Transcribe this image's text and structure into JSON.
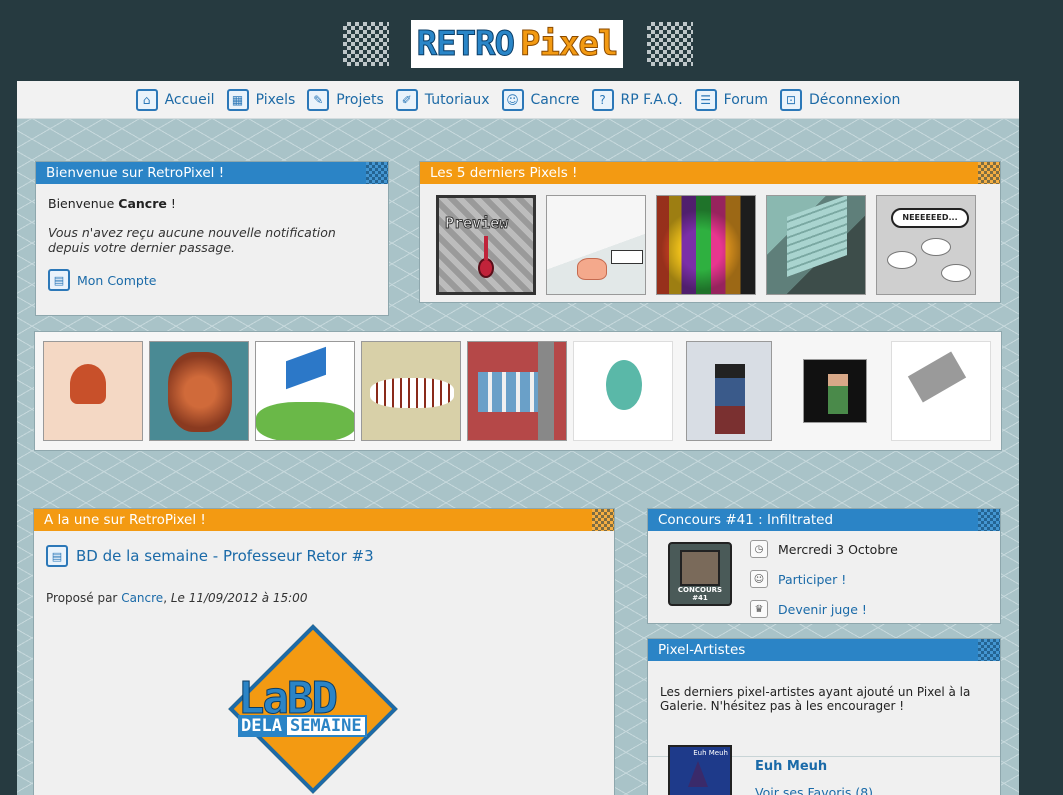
{
  "logo": {
    "retro": "RETRO",
    "pixel": "Pixel"
  },
  "nav": [
    {
      "label": "Accueil",
      "icon": "home-icon",
      "glyph": "⌂"
    },
    {
      "label": "Pixels",
      "icon": "pixels-icon",
      "glyph": "▦"
    },
    {
      "label": "Projets",
      "icon": "pencil-icon",
      "glyph": "✎"
    },
    {
      "label": "Tutoriaux",
      "icon": "tutorial-icon",
      "glyph": "✐"
    },
    {
      "label": "Cancre",
      "icon": "user-icon",
      "glyph": "☺"
    },
    {
      "label": "RP F.A.Q.",
      "icon": "question-icon",
      "glyph": "?"
    },
    {
      "label": "Forum",
      "icon": "chat-icon",
      "glyph": "☰"
    },
    {
      "label": "Déconnexion",
      "icon": "lock-icon",
      "glyph": "⊡"
    }
  ],
  "welcome": {
    "title": "Bienvenue sur RetroPixel !",
    "greeting_prefix": "Bienvenue",
    "username": "Cancre",
    "greeting_suffix": "!",
    "notification": "Vous n'avez reçu aucune nouvelle notification depuis votre dernier passage.",
    "account_link": "Mon Compte"
  },
  "latest_pixels": {
    "title": "Les 5 derniers Pixels !",
    "preview_text": "Preview",
    "bubble_text": "NEEEEEED..."
  },
  "featured": {
    "title": "A la une sur RetroPixel !",
    "article_title": "BD de la semaine - Professeur Retor #3",
    "proposed_by": "Proposé par",
    "author": "Cancre",
    "date": "Le 11/09/2012 à 15:00",
    "logo_top": "LaBD",
    "logo_bottom_a": "DELA",
    "logo_bottom_b": "SEMAINE"
  },
  "contest": {
    "title": "Concours #41 : Infiltrated",
    "image_label": "CONCOURS #41",
    "date": "Mercredi 3 Octobre",
    "participate": "Participer !",
    "judge": "Devenir juge !"
  },
  "artists": {
    "title": "Pixel-Artistes",
    "description": "Les derniers pixel-artistes ayant ajouté un Pixel à la Galerie. N'hésitez pas à les encourager !",
    "name": "Euh Meuh",
    "favorites": "Voir ses Favoris (8)",
    "avatar_label": "Euh Meuh"
  },
  "colors": {
    "blue": "#2b84c6",
    "orange": "#f39a12",
    "bg": "#263a40"
  }
}
